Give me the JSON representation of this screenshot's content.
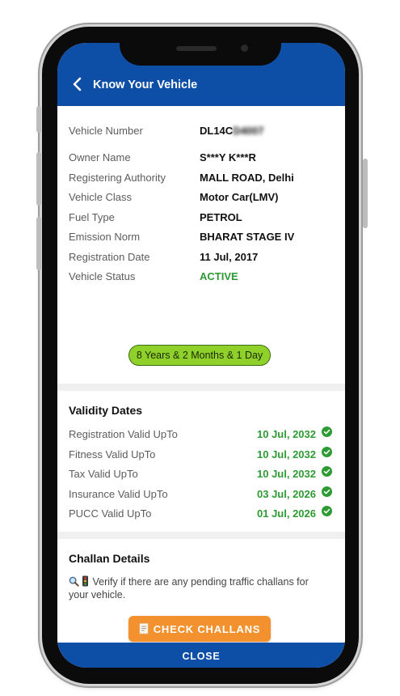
{
  "header": {
    "title": "Know Your Vehicle",
    "back_icon": "chevron-left-icon"
  },
  "vehicle": {
    "rows": [
      {
        "label": "Vehicle Number",
        "value": "DL14C",
        "value_obscured": "D4007"
      },
      {
        "label": "Owner Name",
        "value": "S***Y K***R"
      },
      {
        "label": "Registering Authority",
        "value": "MALL ROAD, Delhi"
      },
      {
        "label": "Vehicle Class",
        "value": "Motor Car(LMV)"
      },
      {
        "label": "Fuel Type",
        "value": "PETROL"
      },
      {
        "label": "Emission Norm",
        "value": "BHARAT STAGE IV"
      },
      {
        "label": "Registration Date",
        "value": "11 Jul, 2017"
      },
      {
        "label": "Vehicle Status",
        "value": "ACTIVE"
      }
    ],
    "age": "8 Years & 2 Months & 1 Day"
  },
  "validity": {
    "title": "Validity Dates",
    "rows": [
      {
        "label": "Registration Valid UpTo",
        "date": "10 Jul, 2032"
      },
      {
        "label": "Fitness Valid UpTo",
        "date": "10 Jul, 2032"
      },
      {
        "label": "Tax Valid UpTo",
        "date": "10 Jul, 2032"
      },
      {
        "label": "Insurance Valid UpTo",
        "date": "03 Jul, 2026"
      },
      {
        "label": "PUCC Valid UpTo",
        "date": "01 Jul, 2026"
      }
    ]
  },
  "challan": {
    "title": "Challan Details",
    "description": "Verify if there are any pending traffic challans for your vehicle.",
    "button_label": "CHECK CHALLANS",
    "icons": [
      "magnifier-icon",
      "traffic-light-icon",
      "receipt-icon"
    ]
  },
  "footer": {
    "close_label": "CLOSE"
  },
  "colors": {
    "brand_blue": "#0d4ea6",
    "status_green": "#2e9a34",
    "pill_green": "#8fd12a",
    "button_orange": "#f2912d"
  }
}
